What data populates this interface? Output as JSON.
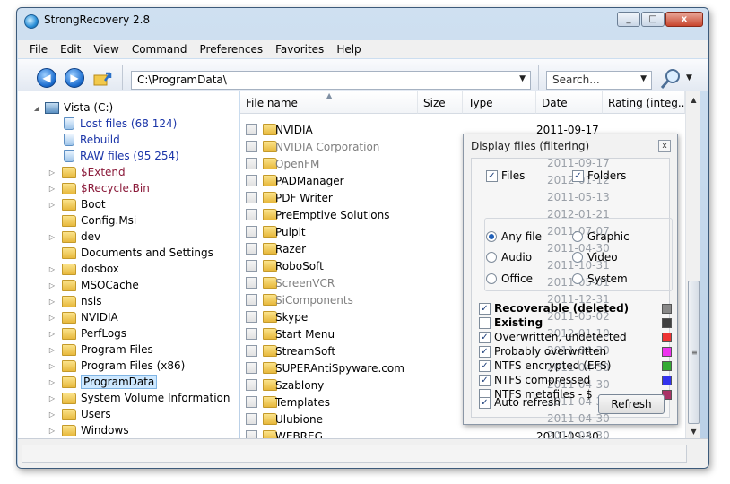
{
  "window": {
    "title": "StrongRecovery 2.8",
    "controls": [
      "_",
      "□",
      "x"
    ]
  },
  "menu": [
    "File",
    "Edit",
    "View",
    "Command",
    "Preferences",
    "Favorites",
    "Help"
  ],
  "toolbar": {
    "path": "C:\\ProgramData\\",
    "search_placeholder": "Search...",
    "back_glyph": "◀",
    "forward_glyph": "▶",
    "dropdown_glyph": "▼"
  },
  "tree": [
    {
      "label": "Vista (C:)",
      "type": "drive",
      "color": "normal",
      "expander": "◢"
    },
    {
      "label": "Lost files (68 124)",
      "type": "bin",
      "color": "blue"
    },
    {
      "label": "Rebuild",
      "type": "bin",
      "color": "blue"
    },
    {
      "label": "RAW files (95 254)",
      "type": "bin",
      "color": "blue"
    },
    {
      "label": "$Extend",
      "type": "folder",
      "color": "maroon",
      "expander": "▷"
    },
    {
      "label": "$Recycle.Bin",
      "type": "folder",
      "color": "maroon",
      "expander": "▷"
    },
    {
      "label": "Boot",
      "type": "folder",
      "color": "normal",
      "expander": "▷"
    },
    {
      "label": "Config.Msi",
      "type": "folder",
      "color": "normal",
      "expander": ""
    },
    {
      "label": "dev",
      "type": "folder",
      "color": "normal",
      "expander": "▷"
    },
    {
      "label": "Documents and Settings",
      "type": "folder",
      "color": "normal",
      "expander": ""
    },
    {
      "label": "dosbox",
      "type": "folder",
      "color": "normal",
      "expander": "▷"
    },
    {
      "label": "MSOCache",
      "type": "folder",
      "color": "normal",
      "expander": "▷"
    },
    {
      "label": "nsis",
      "type": "folder",
      "color": "normal",
      "expander": "▷"
    },
    {
      "label": "NVIDIA",
      "type": "folder",
      "color": "normal",
      "expander": "▷"
    },
    {
      "label": "PerfLogs",
      "type": "folder",
      "color": "normal",
      "expander": "▷"
    },
    {
      "label": "Program Files",
      "type": "folder",
      "color": "normal",
      "expander": "▷"
    },
    {
      "label": "Program Files (x86)",
      "type": "folder",
      "color": "normal",
      "expander": "▷"
    },
    {
      "label": "ProgramData",
      "type": "folder",
      "color": "normal",
      "expander": "▷",
      "selected": true
    },
    {
      "label": "System Volume Information",
      "type": "folder",
      "color": "normal",
      "expander": "▷"
    },
    {
      "label": "Users",
      "type": "folder",
      "color": "normal",
      "expander": "▷"
    },
    {
      "label": "Windows",
      "type": "folder",
      "color": "normal",
      "expander": "▷"
    }
  ],
  "columns": [
    "File name",
    "Size",
    "Type",
    "Date",
    "Rating (integ..."
  ],
  "sort_glyph": "▲",
  "files": [
    {
      "name": "NVIDIA",
      "grey": false,
      "date": "2011-09-17"
    },
    {
      "name": "NVIDIA Corporation",
      "grey": true,
      "date": ""
    },
    {
      "name": "OpenFM",
      "grey": true,
      "date": ""
    },
    {
      "name": "PADManager",
      "grey": false,
      "date": ""
    },
    {
      "name": "PDF Writer",
      "grey": false,
      "date": ""
    },
    {
      "name": "PreEmptive Solutions",
      "grey": false,
      "date": ""
    },
    {
      "name": "Pulpit",
      "grey": false,
      "date": ""
    },
    {
      "name": "Razer",
      "grey": false,
      "date": ""
    },
    {
      "name": "RoboSoft",
      "grey": false,
      "date": ""
    },
    {
      "name": "ScreenVCR",
      "grey": true,
      "date": ""
    },
    {
      "name": "SiComponents",
      "grey": true,
      "date": ""
    },
    {
      "name": "Skype",
      "grey": false,
      "date": ""
    },
    {
      "name": "Start Menu",
      "grey": false,
      "date": ""
    },
    {
      "name": "StreamSoft",
      "grey": false,
      "date": ""
    },
    {
      "name": "SUPERAntiSpyware.com",
      "grey": false,
      "date": ""
    },
    {
      "name": "Szablony",
      "grey": false,
      "date": ""
    },
    {
      "name": "Templates",
      "grey": false,
      "date": ""
    },
    {
      "name": "Ulubione",
      "grey": false,
      "date": ""
    },
    {
      "name": "WEBREG",
      "grey": false,
      "date": "2011-09-30"
    }
  ],
  "filter_dialog": {
    "title": "Display files (filtering)",
    "close_glyph": "x",
    "checkmark_glyph": "✓",
    "files_label": "Files",
    "folders_label": "Folders",
    "radios": [
      {
        "label": "Any file",
        "on": true
      },
      {
        "label": "Graphic",
        "on": false
      },
      {
        "label": "Audio",
        "on": false
      },
      {
        "label": "Video",
        "on": false
      },
      {
        "label": "Office",
        "on": false
      },
      {
        "label": "System",
        "on": false
      }
    ],
    "states": [
      {
        "label": "Recoverable (deleted)",
        "checked": true,
        "bold": true,
        "color": "#888888"
      },
      {
        "label": "Existing",
        "checked": false,
        "bold": true,
        "color": "#404040"
      },
      {
        "label": "Overwritten, undetected",
        "checked": true,
        "bold": false,
        "color": "#ee3333"
      },
      {
        "label": "Probably overwritten",
        "checked": true,
        "bold": false,
        "color": "#ee33ee"
      },
      {
        "label": "NTFS encrypted (EFS)",
        "checked": true,
        "bold": false,
        "color": "#33aa33"
      },
      {
        "label": "NTFS compressed",
        "checked": true,
        "bold": false,
        "color": "#3333ee"
      },
      {
        "label": "NTFS metafiles - $",
        "checked": false,
        "bold": false,
        "color": "#aa3366"
      }
    ],
    "auto_refresh_label": "Auto refresh",
    "refresh_label": "Refresh",
    "ghost_dates": [
      "2011-09-17",
      "2012-01-12",
      "2011-05-13",
      "2012-01-21",
      "2011-07-07",
      "2011-04-30",
      "2011-10-31",
      "2011-05-01",
      "2011-12-31",
      "2011-05-02",
      "2012-01-10",
      "2011-04-30",
      "2011-04-30",
      "2011-04-30",
      "2011-04-30",
      "2011-04-30",
      "2011-04-30"
    ]
  }
}
